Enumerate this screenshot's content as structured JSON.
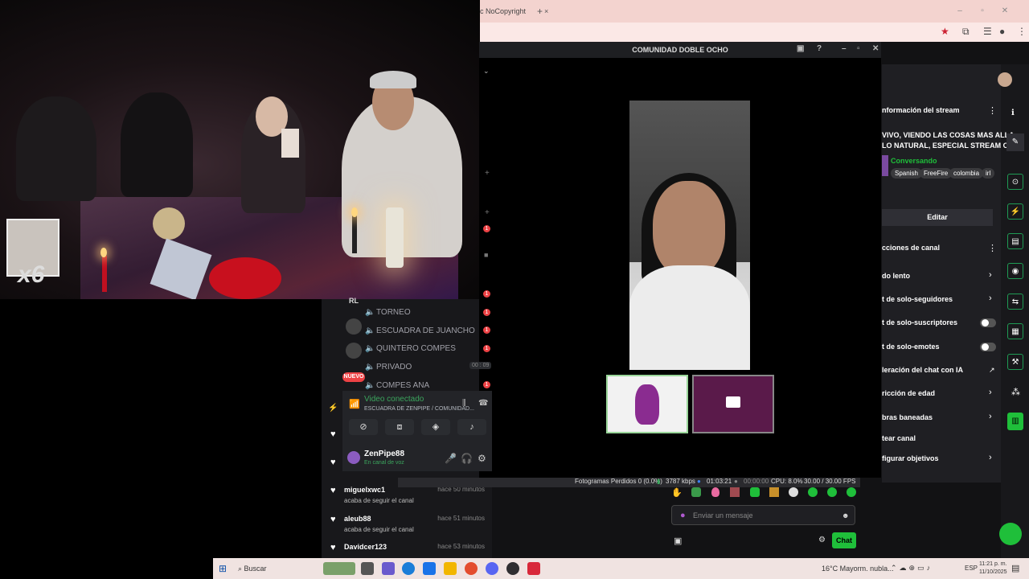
{
  "chrome": {
    "tab_title": "c NoCopyright",
    "tab_close": "×",
    "new_tab": "+",
    "win_min": "–",
    "win_max": "▫",
    "win_close": "✕"
  },
  "stream_overlay": {
    "multiplier_label": "x6"
  },
  "discord": {
    "window_title": "COMUNIDAD DOBLE OCHO",
    "channels": [
      {
        "name": "TORNEO",
        "badge": "1"
      },
      {
        "name": "ESCUADRA DE JUANCHO",
        "badge": "1"
      },
      {
        "name": "QUINTERO COMPES",
        "badge": "1"
      },
      {
        "name": "PRIVADO",
        "badge": ""
      },
      {
        "name": "COMPES ANA",
        "badge": "1"
      }
    ],
    "server_label": "RL",
    "new_badge": "NUEVO",
    "time_badge": "00 : 09",
    "voice_status": "Video conectado",
    "voice_channel": "ESCUADRA DE ZENPIPE / COMUNIDAD...",
    "user_name": "ZenPipe88",
    "user_status": "En canal de voz"
  },
  "activity_feed": [
    {
      "name": "miguelxwc1",
      "action": "acaba de seguir el canal",
      "time": "hace 50 minutos"
    },
    {
      "name": "aleub88",
      "action": "acaba de seguir el canal",
      "time": "hace 51 minutos"
    },
    {
      "name": "Davidcer123",
      "action": "",
      "time": "hace 53 minutos"
    }
  ],
  "obs_stats": {
    "dropped": "Fotogramas Perdidos 0 (0.0%)",
    "bitrate": "3787 kbps",
    "live_time": "01:03:21",
    "rec_time": "00:00:00",
    "cpu": "CPU: 8.0%",
    "fps": "30.00 / 30.00 FPS"
  },
  "stream_info": {
    "heading": "nformación del stream",
    "title_line1": "VIVO, VIENDO LAS COSAS MAS ALLA",
    "title_line2": "LO NATURAL, ESPECIAL STREAM C...",
    "category": "Conversando",
    "tags": [
      "Spanish",
      "FreeFire",
      "colombia",
      "irl"
    ],
    "edit_label": "Editar",
    "channel_actions_heading": "cciones de canal",
    "actions": [
      {
        "label": "do lento",
        "control": "chevron"
      },
      {
        "label": "t de solo-seguidores",
        "control": "chevron"
      },
      {
        "label": "t de solo-suscriptores",
        "control": "toggle"
      },
      {
        "label": "t de solo-emotes",
        "control": "toggle"
      },
      {
        "label": "leración del chat con IA",
        "control": "external"
      },
      {
        "label": "ricción de edad",
        "control": "chevron"
      },
      {
        "label": "bras baneadas",
        "control": "chevron"
      },
      {
        "label": "tear canal",
        "control": "none"
      },
      {
        "label": "figurar objetivos",
        "control": "chevron"
      }
    ]
  },
  "chat": {
    "input_placeholder": "Enviar un mensaje",
    "send_label": "Chat"
  },
  "taskbar": {
    "search_label": "Buscar",
    "weather": "16°C  Mayorm. nubla...",
    "lang": "ESP",
    "time": "11:21 p. m.",
    "date": "11/10/2025"
  }
}
